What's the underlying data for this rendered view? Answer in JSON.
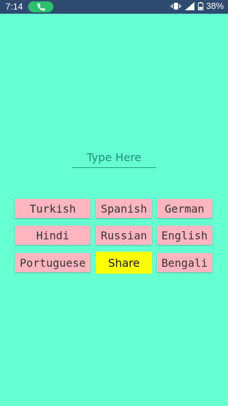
{
  "status_bar": {
    "time": "7:14",
    "battery": "38%",
    "icons": [
      "call-active-icon",
      "vibrate-icon",
      "signal-icon",
      "battery-icon"
    ]
  },
  "input": {
    "placeholder": "Type Here",
    "value": ""
  },
  "languages": {
    "turkish": "Turkish",
    "spanish": "Spanish",
    "german": "German",
    "hindi": "Hindi",
    "russian": "Russian",
    "english": "English",
    "portuguese": "Portuguese",
    "bengali": "Bengali"
  },
  "share_label": "Share",
  "colors": {
    "background": "#66FFD1",
    "status_bar": "#2E4A6E",
    "language_button": "#FFB6C1",
    "share_button": "#FFFF00",
    "accent": "#1B9C86"
  }
}
